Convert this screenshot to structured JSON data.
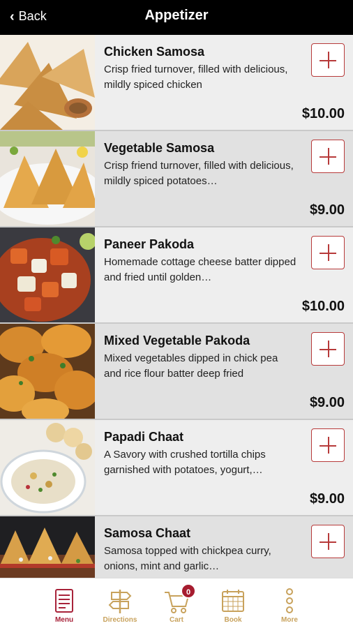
{
  "header": {
    "back_label": "Back",
    "title": "Appetizer"
  },
  "items": [
    {
      "name": "Chicken Samosa",
      "description": "Crisp fried turnover, filled with delicious, mildly spiced chicken",
      "price": "$10.00"
    },
    {
      "name": "Vegetable Samosa",
      "description": "Crisp friend turnover, filled with delicious, mildly spiced potatoes…",
      "price": "$9.00"
    },
    {
      "name": "Paneer Pakoda",
      "description": "Homemade cottage cheese batter dipped and fried until golden…",
      "price": "$10.00"
    },
    {
      "name": "Mixed Vegetable Pakoda",
      "description": "Mixed vegetables dipped in chick pea and rice flour batter deep fried",
      "price": "$9.00"
    },
    {
      "name": "Papadi Chaat",
      "description": "A Savory with crushed tortilla chips garnished with potatoes, yogurt,…",
      "price": "$9.00"
    },
    {
      "name": "Samosa Chaat",
      "description": "Samosa topped with chickpea curry, onions, mint and garlic…",
      "price": ""
    }
  ],
  "tabbar": {
    "tabs": [
      {
        "label": "Menu",
        "icon": "menu-list-icon"
      },
      {
        "label": "Directions",
        "icon": "signpost-icon"
      },
      {
        "label": "Cart",
        "icon": "cart-icon"
      },
      {
        "label": "Book",
        "icon": "calendar-icon"
      },
      {
        "label": "More",
        "icon": "more-dots-icon"
      }
    ],
    "cart_count": "0",
    "active_color": "#a8233a",
    "inactive_color": "#c8a25c"
  },
  "colors": {
    "header_bg": "#000000",
    "accent": "#b73a3a"
  }
}
